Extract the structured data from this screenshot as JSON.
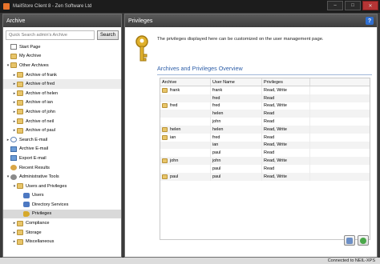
{
  "window": {
    "title": "MailStore Client 8 - Zen Software Ltd",
    "controls": [
      "–",
      "□",
      "✕"
    ]
  },
  "left": {
    "header": "Archive",
    "search_placeholder": "Quick Search admin's Archive",
    "search_button": "Search",
    "tree": [
      {
        "label": "Start Page",
        "icon": "page-icon",
        "level": 0,
        "expander": ""
      },
      {
        "label": "My Archive",
        "icon": "folder-icon",
        "level": 0,
        "expander": ""
      },
      {
        "label": "Other Archives",
        "icon": "folder-icon",
        "level": 0,
        "expander": "▾"
      },
      {
        "label": "Archive of frank",
        "icon": "folder-icon",
        "level": 1,
        "expander": "▸"
      },
      {
        "label": "Archive of fred",
        "icon": "folder-icon",
        "level": 1,
        "expander": "▸",
        "selected": true
      },
      {
        "label": "Archive of helen",
        "icon": "folder-icon",
        "level": 1,
        "expander": "▸"
      },
      {
        "label": "Archive of ian",
        "icon": "folder-icon",
        "level": 1,
        "expander": "▸"
      },
      {
        "label": "Archive of john",
        "icon": "folder-icon",
        "level": 1,
        "expander": "▸"
      },
      {
        "label": "Archive of neil",
        "icon": "folder-icon",
        "level": 1,
        "expander": "▸"
      },
      {
        "label": "Archive of paul",
        "icon": "folder-icon",
        "level": 1,
        "expander": "▸"
      },
      {
        "label": "Search E-mail",
        "icon": "search-icon",
        "level": 0,
        "expander": "▸"
      },
      {
        "label": "Archive E-mail",
        "icon": "email-icon",
        "level": 0,
        "expander": ""
      },
      {
        "label": "Export E-mail",
        "icon": "email-icon",
        "level": 0,
        "expander": ""
      },
      {
        "label": "Recent Results",
        "icon": "recent-icon",
        "level": 0,
        "expander": ""
      },
      {
        "label": "Administrative Tools",
        "icon": "gear-icon",
        "level": 0,
        "expander": "▾"
      },
      {
        "label": "Users and Privileges",
        "icon": "folder-icon",
        "level": 1,
        "expander": "▾"
      },
      {
        "label": "Users",
        "icon": "users-icon",
        "level": 2,
        "expander": ""
      },
      {
        "label": "Directory Services",
        "icon": "users-icon",
        "level": 2,
        "expander": ""
      },
      {
        "label": "Privileges",
        "icon": "key-icon",
        "level": 2,
        "expander": "",
        "active": true
      },
      {
        "label": "Compliance",
        "icon": "folder-icon",
        "level": 1,
        "expander": "▸"
      },
      {
        "label": "Storage",
        "icon": "folder-icon",
        "level": 1,
        "expander": "▸"
      },
      {
        "label": "Miscellaneous",
        "icon": "folder-icon",
        "level": 1,
        "expander": "▸"
      }
    ]
  },
  "right": {
    "header": "Privileges",
    "help": "?",
    "info": "The privileges displayed here can be customized on the user management page.",
    "overview_title": "Archives and Privileges Overview",
    "columns": [
      "Archive",
      "User Name",
      "Privileges"
    ],
    "rows": [
      {
        "archive": "frank",
        "user": "frank",
        "privileges": "Read, Write"
      },
      {
        "archive": "",
        "user": "fred",
        "privileges": "Read"
      },
      {
        "archive": "fred",
        "user": "fred",
        "privileges": "Read, Write"
      },
      {
        "archive": "",
        "user": "helen",
        "privileges": "Read"
      },
      {
        "archive": "",
        "user": "john",
        "privileges": "Read"
      },
      {
        "archive": "helen",
        "user": "helen",
        "privileges": "Read, Write"
      },
      {
        "archive": "ian",
        "user": "fred",
        "privileges": "Read"
      },
      {
        "archive": "",
        "user": "ian",
        "privileges": "Read, Write"
      },
      {
        "archive": "",
        "user": "paul",
        "privileges": "Read"
      },
      {
        "archive": "john",
        "user": "john",
        "privileges": "Read, Write"
      },
      {
        "archive": "",
        "user": "paul",
        "privileges": "Read"
      },
      {
        "archive": "paul",
        "user": "paul",
        "privileges": "Read, Write"
      }
    ]
  },
  "status": "Connected to NEIL-XPS"
}
